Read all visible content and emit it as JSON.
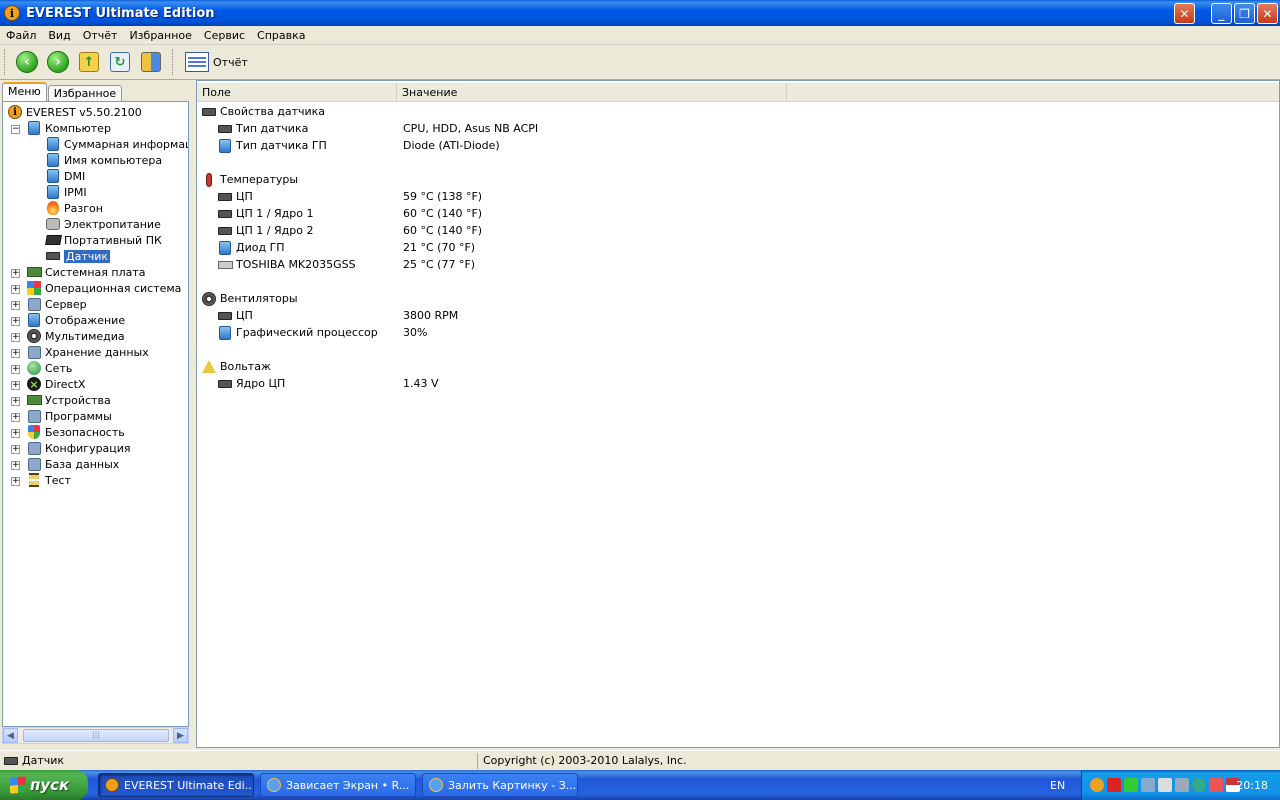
{
  "window": {
    "title": "EVEREST Ultimate Edition",
    "minimize_glyph": "_",
    "maximize_glyph": "❐",
    "close_glyph": "✕",
    "left_close_glyph": "✕"
  },
  "menu": [
    "Файл",
    "Вид",
    "Отчёт",
    "Избранное",
    "Сервис",
    "Справка"
  ],
  "toolbar": {
    "report_label": "Отчёт",
    "icons": [
      "back-icon",
      "forward-icon",
      "up-icon",
      "refresh-icon",
      "users-icon",
      "report-icon"
    ]
  },
  "tabs": {
    "menu": "Меню",
    "favorites": "Избранное"
  },
  "tree": {
    "root": "EVEREST v5.50.2100",
    "computer": "Компьютер",
    "computer_children": [
      "Суммарная информация",
      "Имя компьютера",
      "DMI",
      "IPMI",
      "Разгон",
      "Электропитание",
      "Портативный ПК",
      "Датчик"
    ],
    "top": [
      "Системная плата",
      "Операционная система",
      "Сервер",
      "Отображение",
      "Мультимедиа",
      "Хранение данных",
      "Сеть",
      "DirectX",
      "Устройства",
      "Программы",
      "Безопасность",
      "Конфигурация",
      "База данных",
      "Тест"
    ]
  },
  "columns": {
    "field": "Поле",
    "value": "Значение"
  },
  "sections": {
    "sensor": {
      "title": "Свойства датчика",
      "rows": [
        {
          "field": "Тип датчика",
          "value": "CPU, HDD, Asus NB ACPI"
        },
        {
          "field": "Тип датчика ГП",
          "value": "Diode  (ATI-Diode)"
        }
      ]
    },
    "temps": {
      "title": "Температуры",
      "rows": [
        {
          "field": "ЦП",
          "value": "59 °C  (138 °F)"
        },
        {
          "field": "ЦП 1 / Ядро 1",
          "value": "60 °C  (140 °F)"
        },
        {
          "field": "ЦП 1 / Ядро 2",
          "value": "60 °C  (140 °F)"
        },
        {
          "field": "Диод ГП",
          "value": "21 °C  (70 °F)"
        },
        {
          "field": "TOSHIBA MK2035GSS",
          "value": "25 °C  (77 °F)"
        }
      ]
    },
    "fans": {
      "title": "Вентиляторы",
      "rows": [
        {
          "field": "ЦП",
          "value": "3800 RPM"
        },
        {
          "field": "Графический процессор",
          "value": "30%"
        }
      ]
    },
    "volt": {
      "title": "Вольтаж",
      "rows": [
        {
          "field": "Ядро ЦП",
          "value": "1.43 V"
        }
      ]
    }
  },
  "status": {
    "left": "Датчик",
    "right": "Copyright (c) 2003-2010 Lalalys, Inc."
  },
  "taskbar": {
    "start": "пуск",
    "tasks": [
      "EVEREST Ultimate Edi...",
      "Зависает Экран • R...",
      "Залить Картинку - З..."
    ],
    "lang": "EN",
    "clock": "20:18"
  }
}
